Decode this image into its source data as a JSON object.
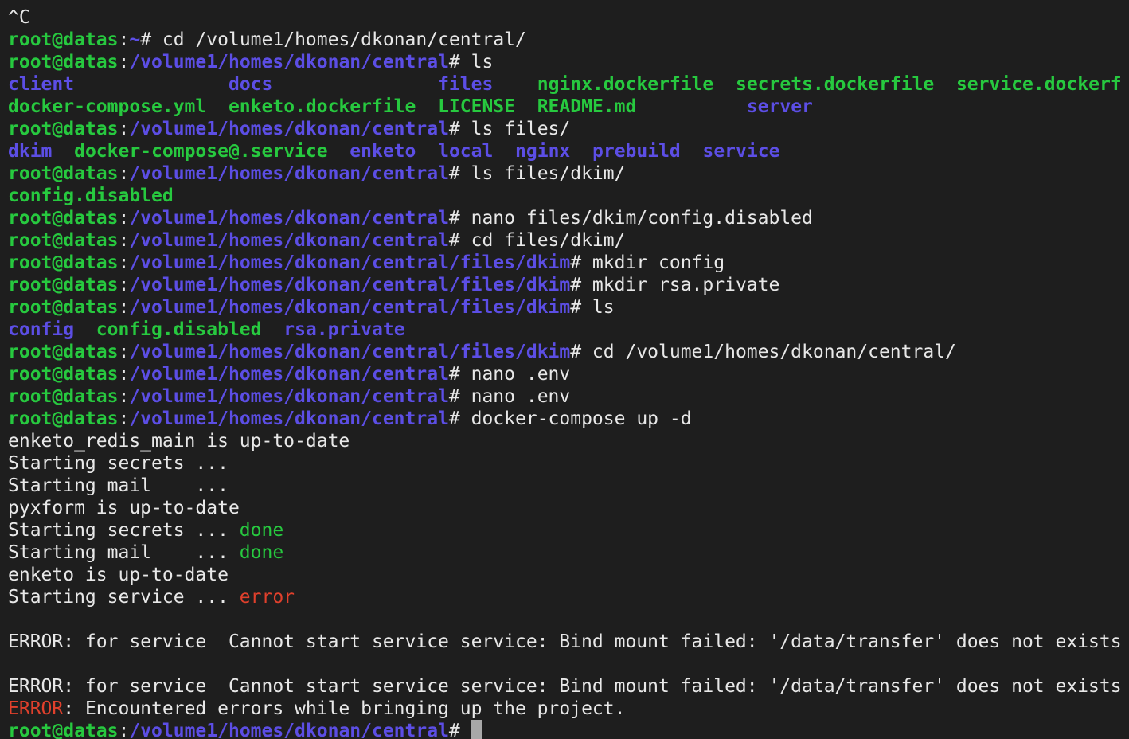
{
  "colors": {
    "background": "#1e1e1e",
    "default": "#e8e8e8",
    "user": "#27c93f",
    "path": "#5c4ee5",
    "dir": "#5c4ee5",
    "file": "#27c93f",
    "ok": "#27c93f",
    "err": "#e0402c"
  },
  "lines": [
    {
      "mark": false,
      "segments": [
        {
          "t": "^C",
          "c": "default"
        }
      ]
    },
    {
      "mark": true,
      "segments": [
        {
          "t": "root@datas",
          "c": "user"
        },
        {
          "t": ":",
          "c": "default"
        },
        {
          "t": "~",
          "c": "path"
        },
        {
          "t": "# cd /volume1/homes/dkonan/central/",
          "c": "default"
        }
      ]
    },
    {
      "mark": true,
      "segments": [
        {
          "t": "root@datas",
          "c": "user"
        },
        {
          "t": ":",
          "c": "default"
        },
        {
          "t": "/volume1/homes/dkonan/central",
          "c": "path"
        },
        {
          "t": "# ls",
          "c": "default"
        }
      ]
    },
    {
      "mark": false,
      "segments": [
        {
          "t": "client",
          "c": "dir"
        },
        {
          "t": "              ",
          "c": "default"
        },
        {
          "t": "docs",
          "c": "dir"
        },
        {
          "t": "               ",
          "c": "default"
        },
        {
          "t": "files",
          "c": "dir"
        },
        {
          "t": "    ",
          "c": "default"
        },
        {
          "t": "nginx.dockerfile",
          "c": "file"
        },
        {
          "t": "  ",
          "c": "default"
        },
        {
          "t": "secrets.dockerfile",
          "c": "file"
        },
        {
          "t": "  ",
          "c": "default"
        },
        {
          "t": "service.dockerf",
          "c": "file"
        }
      ]
    },
    {
      "mark": false,
      "segments": [
        {
          "t": "docker-compose.yml",
          "c": "file"
        },
        {
          "t": "  ",
          "c": "default"
        },
        {
          "t": "enketo.dockerfile",
          "c": "file"
        },
        {
          "t": "  ",
          "c": "default"
        },
        {
          "t": "LICENSE",
          "c": "file"
        },
        {
          "t": "  ",
          "c": "default"
        },
        {
          "t": "README.md",
          "c": "file"
        },
        {
          "t": "          ",
          "c": "default"
        },
        {
          "t": "server",
          "c": "dir"
        }
      ]
    },
    {
      "mark": true,
      "segments": [
        {
          "t": "root@datas",
          "c": "user"
        },
        {
          "t": ":",
          "c": "default"
        },
        {
          "t": "/volume1/homes/dkonan/central",
          "c": "path"
        },
        {
          "t": "# ls files/",
          "c": "default"
        }
      ]
    },
    {
      "mark": false,
      "segments": [
        {
          "t": "dkim",
          "c": "dir"
        },
        {
          "t": "  ",
          "c": "default"
        },
        {
          "t": "docker-compose@.service",
          "c": "file"
        },
        {
          "t": "  ",
          "c": "default"
        },
        {
          "t": "enketo",
          "c": "dir"
        },
        {
          "t": "  ",
          "c": "default"
        },
        {
          "t": "local",
          "c": "dir"
        },
        {
          "t": "  ",
          "c": "default"
        },
        {
          "t": "nginx",
          "c": "dir"
        },
        {
          "t": "  ",
          "c": "default"
        },
        {
          "t": "prebuild",
          "c": "dir"
        },
        {
          "t": "  ",
          "c": "default"
        },
        {
          "t": "service",
          "c": "dir"
        }
      ]
    },
    {
      "mark": true,
      "segments": [
        {
          "t": "root@datas",
          "c": "user"
        },
        {
          "t": ":",
          "c": "default"
        },
        {
          "t": "/volume1/homes/dkonan/central",
          "c": "path"
        },
        {
          "t": "# ls files/dkim/",
          "c": "default"
        }
      ]
    },
    {
      "mark": false,
      "segments": [
        {
          "t": "config.disabled",
          "c": "file"
        }
      ]
    },
    {
      "mark": true,
      "segments": [
        {
          "t": "root@datas",
          "c": "user"
        },
        {
          "t": ":",
          "c": "default"
        },
        {
          "t": "/volume1/homes/dkonan/central",
          "c": "path"
        },
        {
          "t": "# nano files/dkim/config.disabled",
          "c": "default"
        }
      ]
    },
    {
      "mark": true,
      "segments": [
        {
          "t": "root@datas",
          "c": "user"
        },
        {
          "t": ":",
          "c": "default"
        },
        {
          "t": "/volume1/homes/dkonan/central",
          "c": "path"
        },
        {
          "t": "# cd files/dkim/",
          "c": "default"
        }
      ]
    },
    {
      "mark": true,
      "segments": [
        {
          "t": "root@datas",
          "c": "user"
        },
        {
          "t": ":",
          "c": "default"
        },
        {
          "t": "/volume1/homes/dkonan/central/files/dkim",
          "c": "path"
        },
        {
          "t": "# mkdir config",
          "c": "default"
        }
      ]
    },
    {
      "mark": true,
      "segments": [
        {
          "t": "root@datas",
          "c": "user"
        },
        {
          "t": ":",
          "c": "default"
        },
        {
          "t": "/volume1/homes/dkonan/central/files/dkim",
          "c": "path"
        },
        {
          "t": "# mkdir rsa.private",
          "c": "default"
        }
      ]
    },
    {
      "mark": true,
      "segments": [
        {
          "t": "root@datas",
          "c": "user"
        },
        {
          "t": ":",
          "c": "default"
        },
        {
          "t": "/volume1/homes/dkonan/central/files/dkim",
          "c": "path"
        },
        {
          "t": "# ls",
          "c": "default"
        }
      ]
    },
    {
      "mark": false,
      "segments": [
        {
          "t": "config",
          "c": "dir"
        },
        {
          "t": "  ",
          "c": "default"
        },
        {
          "t": "config.disabled",
          "c": "file"
        },
        {
          "t": "  ",
          "c": "default"
        },
        {
          "t": "rsa.private",
          "c": "dir"
        }
      ]
    },
    {
      "mark": true,
      "segments": [
        {
          "t": "root@datas",
          "c": "user"
        },
        {
          "t": ":",
          "c": "default"
        },
        {
          "t": "/volume1/homes/dkonan/central/files/dkim",
          "c": "path"
        },
        {
          "t": "# cd /volume1/homes/dkonan/central/",
          "c": "default"
        }
      ]
    },
    {
      "mark": true,
      "segments": [
        {
          "t": "root@datas",
          "c": "user"
        },
        {
          "t": ":",
          "c": "default"
        },
        {
          "t": "/volume1/homes/dkonan/central",
          "c": "path"
        },
        {
          "t": "# nano .env",
          "c": "default"
        }
      ]
    },
    {
      "mark": true,
      "segments": [
        {
          "t": "root@datas",
          "c": "user"
        },
        {
          "t": ":",
          "c": "default"
        },
        {
          "t": "/volume1/homes/dkonan/central",
          "c": "path"
        },
        {
          "t": "# nano .env",
          "c": "default"
        }
      ]
    },
    {
      "mark": true,
      "segments": [
        {
          "t": "root@datas",
          "c": "user"
        },
        {
          "t": ":",
          "c": "default"
        },
        {
          "t": "/volume1/homes/dkonan/central",
          "c": "path"
        },
        {
          "t": "# docker-compose up -d",
          "c": "default"
        }
      ]
    },
    {
      "mark": false,
      "segments": [
        {
          "t": "enketo_redis_main is up-to-date",
          "c": "default"
        }
      ]
    },
    {
      "mark": false,
      "segments": [
        {
          "t": "Starting secrets ...",
          "c": "default"
        }
      ]
    },
    {
      "mark": false,
      "segments": [
        {
          "t": "Starting mail    ...",
          "c": "default"
        }
      ]
    },
    {
      "mark": false,
      "segments": [
        {
          "t": "pyxform is up-to-date",
          "c": "default"
        }
      ]
    },
    {
      "mark": false,
      "segments": [
        {
          "t": "Starting secrets ... ",
          "c": "default"
        },
        {
          "t": "done",
          "c": "ok"
        }
      ]
    },
    {
      "mark": false,
      "segments": [
        {
          "t": "Starting mail    ... ",
          "c": "default"
        },
        {
          "t": "done",
          "c": "ok"
        }
      ]
    },
    {
      "mark": false,
      "segments": [
        {
          "t": "enketo is up-to-date",
          "c": "default"
        }
      ]
    },
    {
      "mark": false,
      "segments": [
        {
          "t": "Starting service ... ",
          "c": "default"
        },
        {
          "t": "error",
          "c": "err"
        }
      ]
    },
    {
      "mark": false,
      "segments": [
        {
          "t": "",
          "c": "default"
        }
      ]
    },
    {
      "mark": false,
      "segments": [
        {
          "t": "ERROR: for service  Cannot start service service: Bind mount failed: '/data/transfer' does not exists",
          "c": "default"
        }
      ]
    },
    {
      "mark": false,
      "segments": [
        {
          "t": "",
          "c": "default"
        }
      ]
    },
    {
      "mark": false,
      "segments": [
        {
          "t": "ERROR: for service  Cannot start service service: Bind mount failed: '/data/transfer' does not exists",
          "c": "default"
        }
      ]
    },
    {
      "mark": false,
      "segments": [
        {
          "t": "ERROR",
          "c": "err"
        },
        {
          "t": ": Encountered errors while bringing up the project.",
          "c": "default"
        }
      ]
    },
    {
      "mark": false,
      "cursor": true,
      "segments": [
        {
          "t": "root@datas",
          "c": "user"
        },
        {
          "t": ":",
          "c": "default"
        },
        {
          "t": "/volume1/homes/dkonan/central",
          "c": "path"
        },
        {
          "t": "# ",
          "c": "default"
        }
      ]
    }
  ]
}
